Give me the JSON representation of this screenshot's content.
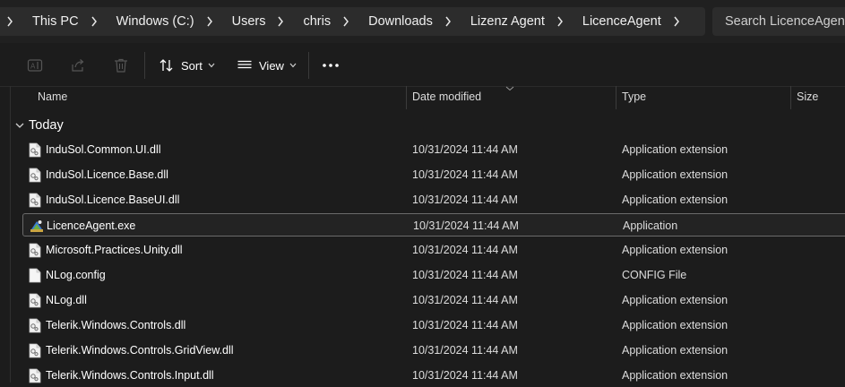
{
  "address_bar": {
    "breadcrumbs": [
      {
        "label": "This PC"
      },
      {
        "label": "Windows (C:)"
      },
      {
        "label": "Users"
      },
      {
        "label": "chris"
      },
      {
        "label": "Downloads"
      },
      {
        "label": "Lizenz Agent"
      },
      {
        "label": "LicenceAgent"
      }
    ],
    "search_placeholder": "Search LicenceAgent"
  },
  "command_bar": {
    "rename_icon": "rename-icon",
    "share_icon": "share-icon",
    "delete_icon": "trash-icon",
    "sort_label": "Sort",
    "view_label": "View",
    "more_icon": "ellipsis-icon"
  },
  "columns": {
    "name": "Name",
    "date_modified": "Date modified",
    "type": "Type",
    "size": "Size"
  },
  "group_label": "Today",
  "files": [
    {
      "name": "InduSol.Common.UI.dll",
      "date": "10/31/2024 11:44 AM",
      "type": "Application extension",
      "icon": "dll-file-icon",
      "selected": false
    },
    {
      "name": "InduSol.Licence.Base.dll",
      "date": "10/31/2024 11:44 AM",
      "type": "Application extension",
      "icon": "dll-file-icon",
      "selected": false
    },
    {
      "name": "InduSol.Licence.BaseUI.dll",
      "date": "10/31/2024 11:44 AM",
      "type": "Application extension",
      "icon": "dll-file-icon",
      "selected": false
    },
    {
      "name": "LicenceAgent.exe",
      "date": "10/31/2024 11:44 AM",
      "type": "Application",
      "icon": "exe-app-icon",
      "selected": true
    },
    {
      "name": "Microsoft.Practices.Unity.dll",
      "date": "10/31/2024 11:44 AM",
      "type": "Application extension",
      "icon": "dll-file-icon",
      "selected": false
    },
    {
      "name": "NLog.config",
      "date": "10/31/2024 11:44 AM",
      "type": "CONFIG File",
      "icon": "blank-file-icon",
      "selected": false
    },
    {
      "name": "NLog.dll",
      "date": "10/31/2024 11:44 AM",
      "type": "Application extension",
      "icon": "dll-file-icon",
      "selected": false
    },
    {
      "name": "Telerik.Windows.Controls.dll",
      "date": "10/31/2024 11:44 AM",
      "type": "Application extension",
      "icon": "dll-file-icon",
      "selected": false
    },
    {
      "name": "Telerik.Windows.Controls.GridView.dll",
      "date": "10/31/2024 11:44 AM",
      "type": "Application extension",
      "icon": "dll-file-icon",
      "selected": false
    },
    {
      "name": "Telerik.Windows.Controls.Input.dll",
      "date": "10/31/2024 11:44 AM",
      "type": "Application extension",
      "icon": "dll-file-icon",
      "selected": false
    }
  ],
  "colors": {
    "background": "#1c1c1c",
    "toolbar": "#202020",
    "field": "#2c2c2c",
    "selection_border": "#6a6a6a"
  }
}
